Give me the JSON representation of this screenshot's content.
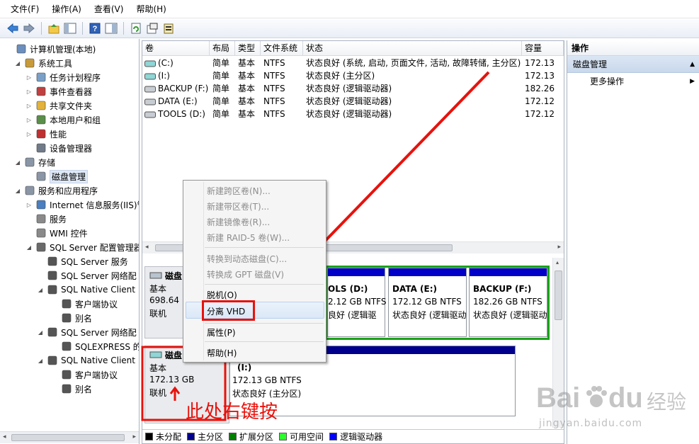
{
  "menu": [
    "文件(F)",
    "操作(A)",
    "查看(V)",
    "帮助(H)"
  ],
  "toolbar_icons": [
    "back-arrow-icon",
    "forward-arrow-icon",
    "up-folder-icon",
    "show-hide-tree-icon",
    "help-icon",
    "console-pane-icon",
    "refresh-icon",
    "properties-icon",
    "export-icon"
  ],
  "tree": [
    {
      "label": "计算机管理(本地)",
      "icon": "computer-icon",
      "level": 0,
      "expander": ""
    },
    {
      "label": "系统工具",
      "icon": "tools-icon",
      "level": 1,
      "expander": "◢"
    },
    {
      "label": "任务计划程序",
      "icon": "clock-icon",
      "level": 2,
      "expander": "▷"
    },
    {
      "label": "事件查看器",
      "icon": "event-viewer-icon",
      "level": 2,
      "expander": "▷"
    },
    {
      "label": "共享文件夹",
      "icon": "shared-folder-icon",
      "level": 2,
      "expander": "▷"
    },
    {
      "label": "本地用户和组",
      "icon": "users-icon",
      "level": 2,
      "expander": "▷"
    },
    {
      "label": "性能",
      "icon": "performance-icon",
      "level": 2,
      "expander": "▷"
    },
    {
      "label": "设备管理器",
      "icon": "device-manager-icon",
      "level": 2,
      "expander": ""
    },
    {
      "label": "存储",
      "icon": "storage-icon",
      "level": 1,
      "expander": "◢"
    },
    {
      "label": "磁盘管理",
      "icon": "disk-management-icon",
      "level": 2,
      "expander": "",
      "selected": true
    },
    {
      "label": "服务和应用程序",
      "icon": "services-apps-icon",
      "level": 1,
      "expander": "◢"
    },
    {
      "label": "Internet 信息服务(IIS)管",
      "icon": "iis-icon",
      "level": 2,
      "expander": "▷"
    },
    {
      "label": "服务",
      "icon": "services-icon",
      "level": 2,
      "expander": ""
    },
    {
      "label": "WMI 控件",
      "icon": "wmi-icon",
      "level": 2,
      "expander": ""
    },
    {
      "label": "SQL Server 配置管理器",
      "icon": "sql-config-icon",
      "level": 2,
      "expander": "◢"
    },
    {
      "label": "SQL Server 服务",
      "icon": "sql-service-icon",
      "level": 3,
      "expander": ""
    },
    {
      "label": "SQL Server 网络配",
      "icon": "sql-network-icon",
      "level": 3,
      "expander": ""
    },
    {
      "label": "SQL Native Client",
      "icon": "sql-client-icon",
      "level": 3,
      "expander": "◢"
    },
    {
      "label": "客户端协议",
      "icon": "protocol-icon",
      "level": 4,
      "expander": ""
    },
    {
      "label": "别名",
      "icon": "alias-icon",
      "level": 4,
      "expander": ""
    },
    {
      "label": "SQL Server 网络配",
      "icon": "sql-network-icon",
      "level": 3,
      "expander": "◢"
    },
    {
      "label": "SQLEXPRESS 的",
      "icon": "sqlexpress-icon",
      "level": 4,
      "expander": ""
    },
    {
      "label": "SQL Native Client",
      "icon": "sql-client-icon",
      "level": 3,
      "expander": "◢"
    },
    {
      "label": "客户端协议",
      "icon": "protocol-icon",
      "level": 4,
      "expander": ""
    },
    {
      "label": "别名",
      "icon": "alias-icon",
      "level": 4,
      "expander": ""
    }
  ],
  "volume_table": {
    "headers": [
      "卷",
      "布局",
      "类型",
      "文件系统",
      "状态",
      "容量"
    ],
    "rows": [
      [
        "(C:)",
        "简单",
        "基本",
        "NTFS",
        "状态良好 (系统, 启动, 页面文件, 活动, 故障转储, 主分区)",
        "172.13"
      ],
      [
        "(I:)",
        "简单",
        "基本",
        "NTFS",
        "状态良好 (主分区)",
        "172.13"
      ],
      [
        "BACKUP (F:)",
        "简单",
        "基本",
        "NTFS",
        "状态良好 (逻辑驱动器)",
        "182.26"
      ],
      [
        "DATA (E:)",
        "简单",
        "基本",
        "NTFS",
        "状态良好 (逻辑驱动器)",
        "172.12"
      ],
      [
        "TOOLS (D:)",
        "简单",
        "基本",
        "NTFS",
        "状态良好 (逻辑驱动器)",
        "172.12"
      ]
    ]
  },
  "disks": {
    "disk0": {
      "label": "磁盘",
      "type": "基本",
      "size": "698.64",
      "status": "联机"
    },
    "disk1": {
      "label": "磁盘",
      "type": "基本",
      "size": "172.13 GB",
      "status": "联机"
    }
  },
  "partitions": {
    "tools": {
      "name": "OLS  (D:)",
      "size": "2.12 GB NTFS",
      "status": "良好 (逻辑驱"
    },
    "data": {
      "name": "DATA  (E:)",
      "size": "172.12 GB NTFS",
      "status": "状态良好 (逻辑驱动"
    },
    "backup": {
      "name": "BACKUP  (F:)",
      "size": "182.26 GB NTFS",
      "status": "状态良好 (逻辑驱动"
    },
    "i": {
      "name": "(I:)",
      "size": "172.13 GB NTFS",
      "status": "状态良好 (主分区)"
    }
  },
  "legend": [
    {
      "label": "未分配",
      "color": "#000000"
    },
    {
      "label": "主分区",
      "color": "#00008c"
    },
    {
      "label": "扩展分区",
      "color": "#008000"
    },
    {
      "label": "可用空间",
      "color": "#2bff2b"
    },
    {
      "label": "逻辑驱动器",
      "color": "#0000ff"
    }
  ],
  "actions": {
    "title": "操作",
    "section": "磁盘管理",
    "more": "更多操作"
  },
  "context_menu": {
    "new_spanned": "新建跨区卷(N)...",
    "new_striped": "新建带区卷(T)...",
    "new_mirrored": "新建镜像卷(R)...",
    "new_raid5": "新建 RAID-5 卷(W)...",
    "convert_dynamic": "转换到动态磁盘(C)...",
    "convert_gpt": "转换成 GPT 磁盘(V)",
    "offline": "脱机(O)",
    "detach_vhd": "分离 VHD",
    "properties": "属性(P)",
    "help": "帮助(H)"
  },
  "annotation": "此处右键按",
  "watermark": {
    "brand": "Bai",
    "brand2": "du",
    "suffix": "经验",
    "url": "jingyan.baidu.com"
  },
  "colors": {
    "accent_red": "#e8120c",
    "logical_blue": "#0000ff",
    "extended_green": "#008000",
    "primary_navy": "#00008c"
  }
}
